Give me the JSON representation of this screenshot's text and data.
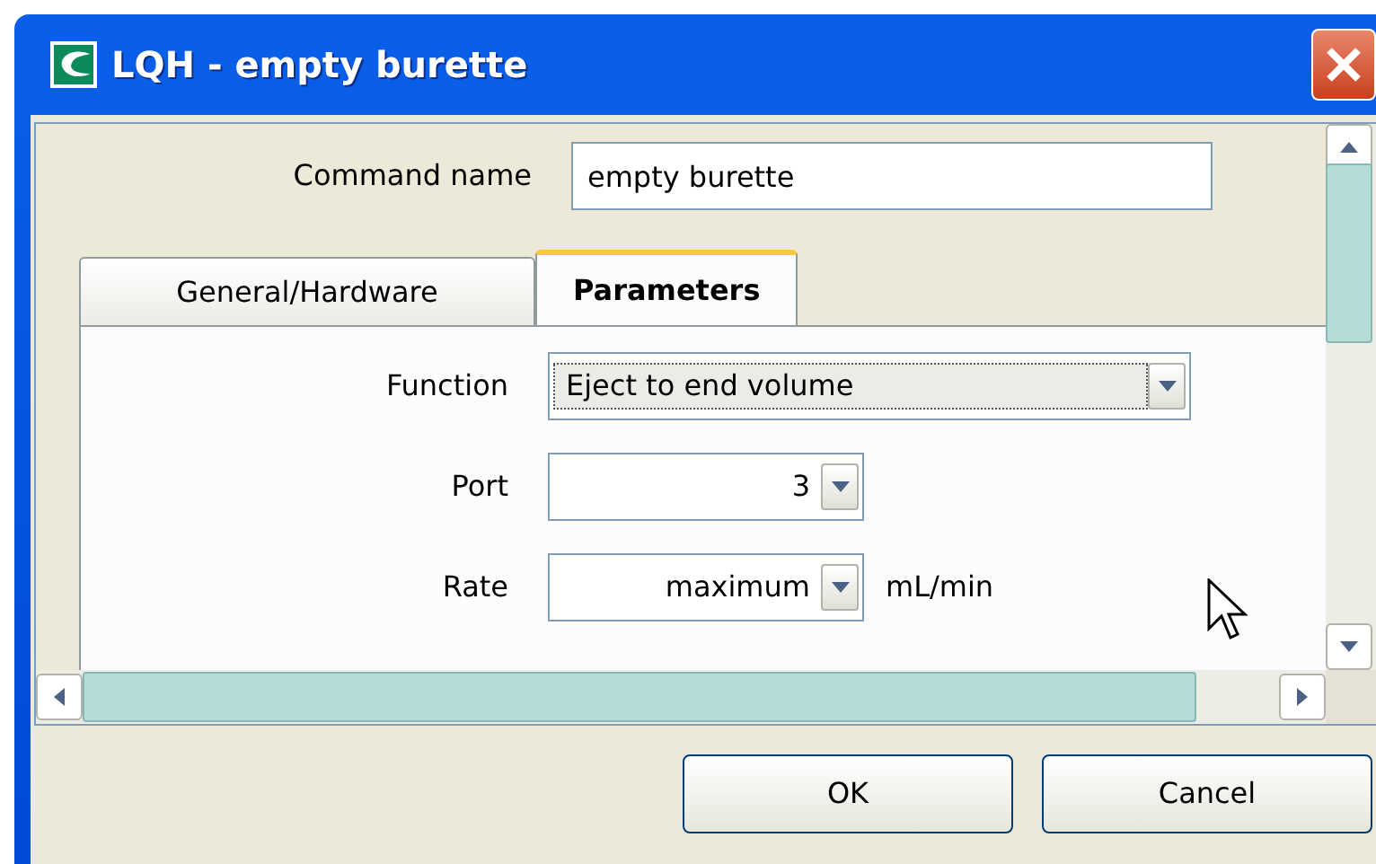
{
  "window": {
    "title": "LQH - empty burette"
  },
  "command_name": {
    "label": "Command name",
    "value": "empty burette"
  },
  "tabs": [
    {
      "label": "General/Hardware",
      "selected": false
    },
    {
      "label": "Parameters",
      "selected": true
    }
  ],
  "fields": [
    {
      "label": "Function",
      "value": "Eject to end volume",
      "kind": "wide"
    },
    {
      "label": "Port",
      "value": "3",
      "kind": "narrow"
    },
    {
      "label": "Rate",
      "value": "maximum",
      "kind": "narrow",
      "unit": "mL/min"
    }
  ],
  "buttons": [
    "OK",
    "Cancel"
  ]
}
